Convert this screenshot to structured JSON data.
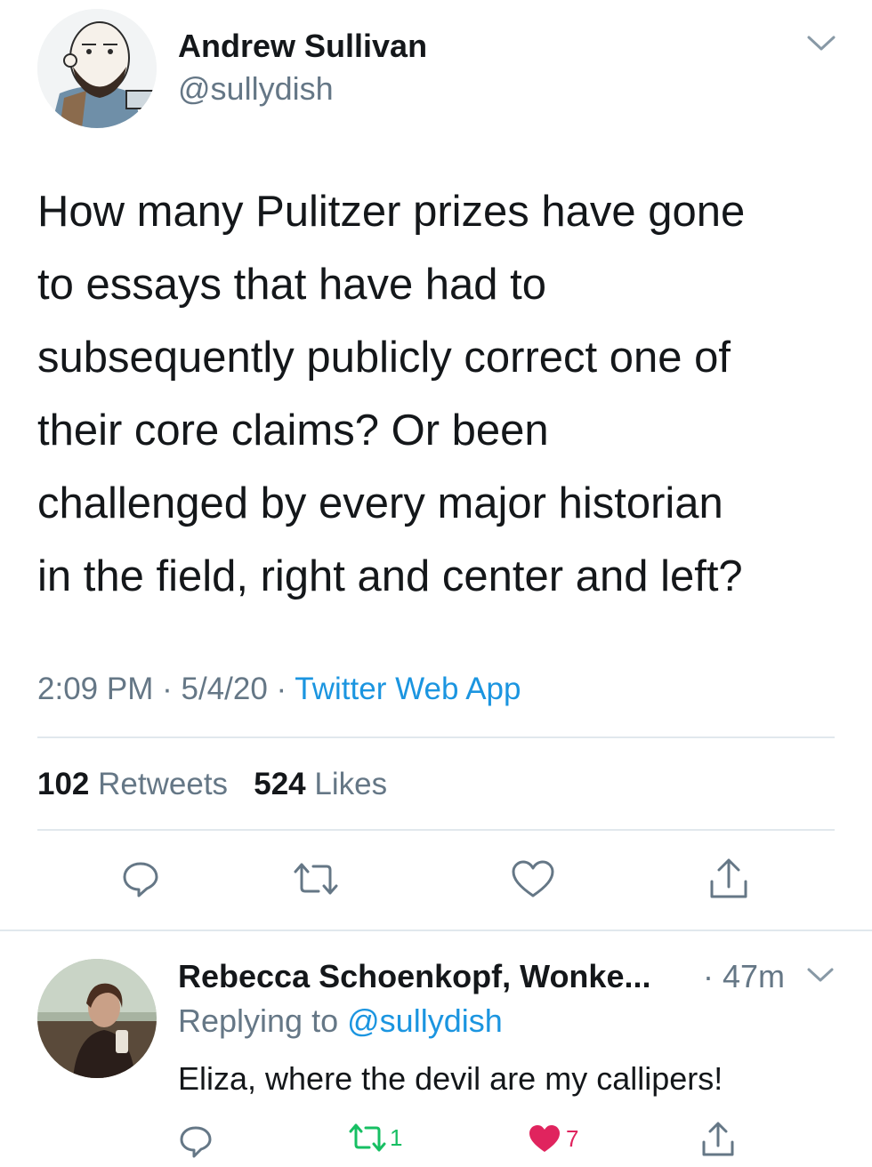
{
  "tweet": {
    "author_name": "Andrew Sullivan",
    "author_handle": "@sullydish",
    "lines": [
      "How many Pulitzer prizes have gone",
      "to essays that have had to",
      "subsequently publicly correct one of",
      "their core claims? Or been",
      "challenged by every major historian",
      "in the field, right and center and left?"
    ],
    "time": "2:09 PM",
    "date": "5/4/20",
    "separator": "·",
    "source": "Twitter Web App",
    "retweets_count": "102",
    "retweets_label": "Retweets",
    "likes_count": "524",
    "likes_label": "Likes"
  },
  "reply": {
    "author_name": "Rebecca Schoenkopf, Wonke...",
    "age": "· 47m",
    "replying_prefix": "Replying to",
    "replying_handle": "@sullydish",
    "text": "Eliza, where the devil are my callipers!",
    "retweet_count": "1",
    "like_count": "7"
  },
  "colors": {
    "text": "#14171a",
    "secondary": "#657786",
    "link": "#1b95e0",
    "divider": "#e1e8ed",
    "retweet_green": "#17bf63",
    "like_red": "#e0245e"
  },
  "icons": [
    "chevron-down-icon",
    "reply-icon",
    "retweet-icon",
    "like-icon",
    "share-icon"
  ]
}
